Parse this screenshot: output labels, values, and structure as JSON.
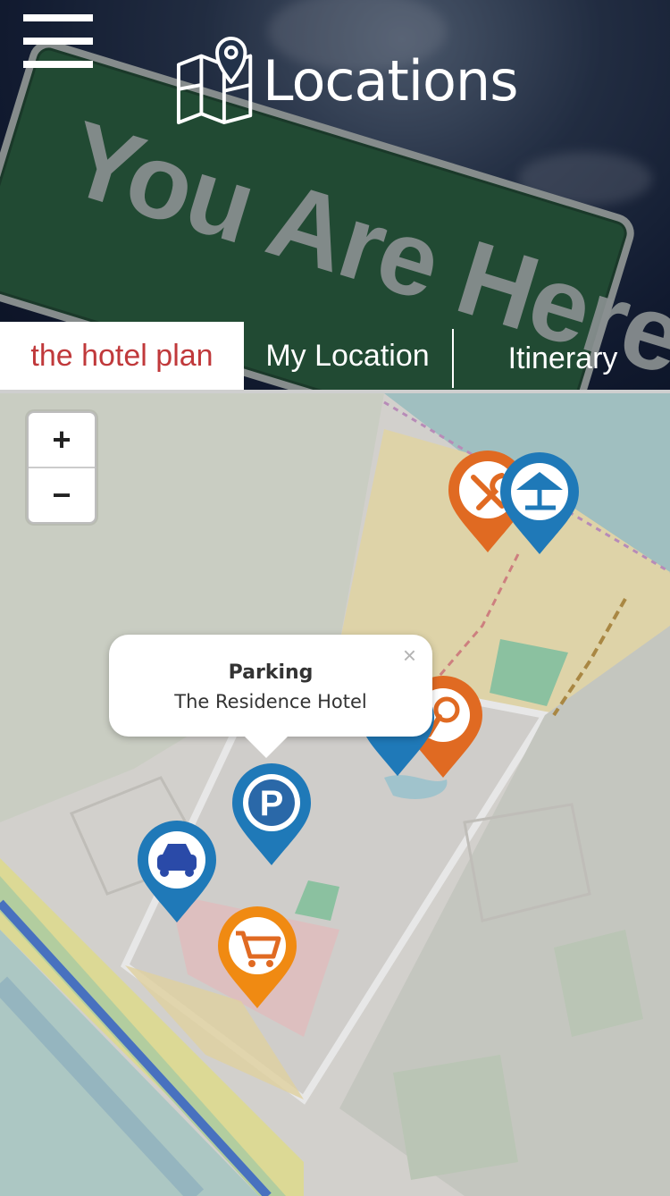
{
  "header": {
    "title": "Locations",
    "background_sign_text": "You Are Here"
  },
  "tabs": [
    {
      "label": "the hotel plan",
      "active": true
    },
    {
      "label": "My Location",
      "active": false
    },
    {
      "label": "Itinerary",
      "active": false
    }
  ],
  "map": {
    "zoom_in_label": "+",
    "zoom_out_label": "−",
    "popup": {
      "title": "Parking",
      "subtitle": "The Residence Hotel",
      "close_label": "×"
    },
    "markers": [
      {
        "name": "restaurant",
        "color": "#e06a22"
      },
      {
        "name": "beach",
        "color": "#1f79b8"
      },
      {
        "name": "pool-bar",
        "color": "#e06a22"
      },
      {
        "name": "parking",
        "color": "#1f79b8"
      },
      {
        "name": "taxi",
        "color": "#1f79b8"
      },
      {
        "name": "shopping",
        "color": "#f08a12"
      }
    ]
  },
  "colors": {
    "accent": "#c0393b",
    "marker_blue": "#1f79b8",
    "marker_orange": "#e06a22"
  }
}
